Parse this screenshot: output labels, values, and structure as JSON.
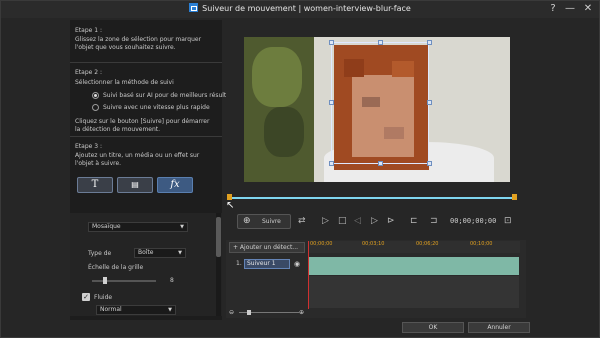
{
  "window": {
    "title": "Suiveur de mouvement  |  women-interview-blur-face",
    "help_label": "?",
    "minimize_label": "—",
    "close_label": "✕"
  },
  "steps": {
    "step1": {
      "heading": "Etape 1 :",
      "text": "Glissez la zone de sélection pour marquer l'objet que vous souhaitez suivre."
    },
    "step2": {
      "heading": "Etape 2 :",
      "text": "Sélectionner la méthode de suivi",
      "options": [
        {
          "label": "Suivi basé sur AI pour de meilleurs résultats",
          "selected": true
        },
        {
          "label": "Suivre avec une vitesse plus rapide",
          "selected": false
        }
      ],
      "hint": "Cliquez sur le bouton [Suivre] pour démarrer la détection de mouvement."
    },
    "step3": {
      "heading": "Etape 3 :",
      "text": "Ajoutez un titre, un média ou un effet sur l'objet à suivre.",
      "buttons": [
        "T",
        "▤",
        "fx"
      ]
    }
  },
  "effect_settings": {
    "effect_dropdown": "Mosaïque",
    "type_label": "Type de",
    "type_value": "Boîte",
    "grid_label": "Échelle de la grille",
    "grid_value_label": "8",
    "grid_fraction": 0.2,
    "fluid_label": "Fluide",
    "fluid_checked": true,
    "fluid_value": "Normal"
  },
  "controls": {
    "track_label": "Suivre",
    "timecode": "00;00;00;00"
  },
  "timeline": {
    "add_button": "+ Ajouter un détect...",
    "ticks": [
      "00;00;00",
      "00;03;10",
      "00;06;20",
      "00;10;00"
    ],
    "track_index": "1.",
    "track_name": "Suiveur 1"
  },
  "footer": {
    "ok": "OK",
    "cancel": "Annuler"
  }
}
